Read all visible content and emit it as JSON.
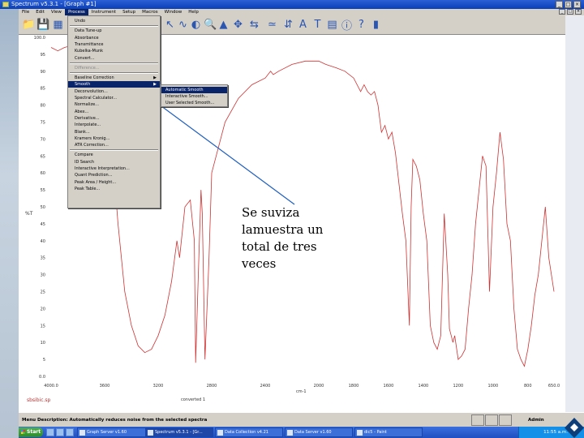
{
  "window": {
    "title": "Spectrum v5.3.1 - [Graph #1]",
    "controls": [
      "_",
      "□",
      "×"
    ]
  },
  "menubar": {
    "items": [
      "File",
      "Edit",
      "View",
      "Process",
      "Instrument",
      "Setup",
      "Macros",
      "Window",
      "Help"
    ],
    "active_index": 3
  },
  "process_menu": {
    "items": [
      {
        "label": "Undo",
        "disabled": false
      },
      {
        "label": "Data Tune-up",
        "disabled": false
      },
      {
        "label": "Absorbance",
        "disabled": false
      },
      {
        "label": "Transmittance",
        "disabled": false
      },
      {
        "label": "Kubelka-Munk",
        "disabled": false
      },
      {
        "label": "Convert...",
        "disabled": false
      },
      {
        "label": "Difference...",
        "disabled": true
      },
      {
        "label": "Baseline Correction",
        "disabled": false,
        "submenu": true
      },
      {
        "label": "Smooth",
        "disabled": false,
        "submenu": true,
        "highlighted": true
      },
      {
        "label": "Deconvolution...",
        "disabled": false
      },
      {
        "label": "Spectral Calculator...",
        "disabled": false
      },
      {
        "label": "Normalize...",
        "disabled": false
      },
      {
        "label": "Abex...",
        "disabled": false
      },
      {
        "label": "Derivative...",
        "disabled": false
      },
      {
        "label": "Interpolate...",
        "disabled": false
      },
      {
        "label": "Blank...",
        "disabled": false
      },
      {
        "label": "Kramers Kronig...",
        "disabled": false
      },
      {
        "label": "ATR Correction...",
        "disabled": false
      },
      {
        "label": "Compare",
        "disabled": false
      },
      {
        "label": "ID Search",
        "disabled": false
      },
      {
        "label": "Interactive Interpretation...",
        "disabled": false
      },
      {
        "label": "Quant Prediction...",
        "disabled": false
      },
      {
        "label": "Peak Area / Height...",
        "disabled": false
      },
      {
        "label": "Peak Table...",
        "disabled": false
      }
    ]
  },
  "smooth_submenu": {
    "items": [
      {
        "label": "Automatic Smooth",
        "highlighted": true
      },
      {
        "label": "Interactive Smooth...",
        "highlighted": false
      },
      {
        "label": "User Selected Smooth...",
        "highlighted": false
      }
    ]
  },
  "annotation": {
    "lines": [
      "Se suviza",
      "lamuestra un",
      "total de tres",
      "veces"
    ]
  },
  "graph": {
    "y_ticks": [
      "100.0",
      "95",
      "90",
      "85",
      "80",
      "75",
      "70",
      "65",
      "60",
      "55",
      "50",
      "45",
      "40",
      "35",
      "30",
      "25",
      "20",
      "15",
      "10",
      "5",
      "0.0"
    ],
    "x_ticks": [
      "4000.0",
      "3600",
      "3200",
      "2800",
      "2400",
      "2000",
      "1800",
      "1600",
      "1400",
      "1200",
      "1000",
      "800",
      "650.0"
    ],
    "ylabel": "%T",
    "xlabel": "cm-1",
    "footer_left": "sbsibic.sp",
    "footer_mid": "converted 1"
  },
  "chart_data": {
    "type": "line",
    "ylabel": "%T",
    "xlabel": "cm-1",
    "ylim": [
      0,
      100
    ],
    "x_ticks": [
      "4000.0",
      "3600",
      "3200",
      "2800",
      "2400",
      "2000",
      "1800",
      "1600",
      "1400",
      "1200",
      "1000",
      "800",
      "650.0"
    ],
    "series": [
      {
        "color": "#d03030",
        "x": [
          4000,
          3950,
          3900,
          3800,
          3700,
          3650,
          3600,
          3550,
          3500,
          3450,
          3400,
          3350,
          3300,
          3250,
          3200,
          3150,
          3100,
          3060,
          3040,
          3000,
          2960,
          2930,
          2920,
          2900,
          2880,
          2870,
          2850,
          2820,
          2800,
          2700,
          2600,
          2500,
          2400,
          2360,
          2340,
          2300,
          2200,
          2100,
          2000,
          1960,
          1900,
          1850,
          1800,
          1760,
          1740,
          1720,
          1700,
          1680,
          1660,
          1640,
          1620,
          1600,
          1580,
          1560,
          1520,
          1500,
          1480,
          1470,
          1460,
          1440,
          1420,
          1400,
          1380,
          1360,
          1340,
          1320,
          1300,
          1280,
          1260,
          1250,
          1240,
          1230,
          1220,
          1200,
          1180,
          1160,
          1140,
          1120,
          1100,
          1080,
          1060,
          1040,
          1020,
          1000,
          980,
          960,
          940,
          920,
          900,
          880,
          860,
          840,
          820,
          800,
          780,
          760,
          740,
          720,
          700,
          680,
          650
        ],
        "y": [
          97,
          96,
          97,
          98,
          96,
          93,
          85,
          70,
          45,
          25,
          15,
          9,
          7,
          8,
          12,
          18,
          28,
          40,
          35,
          50,
          52,
          40,
          4,
          30,
          55,
          48,
          5,
          35,
          60,
          75,
          82,
          86,
          88,
          90,
          89,
          90,
          92,
          93,
          93,
          92,
          91,
          90,
          88,
          84,
          86,
          84,
          83,
          84,
          80,
          72,
          74,
          70,
          72,
          66,
          48,
          40,
          15,
          50,
          64,
          62,
          58,
          48,
          40,
          15,
          10,
          8,
          12,
          48,
          30,
          14,
          12,
          10,
          12,
          5,
          6,
          8,
          20,
          30,
          45,
          55,
          65,
          62,
          25,
          50,
          60,
          72,
          64,
          45,
          40,
          20,
          8,
          5,
          3,
          8,
          15,
          24,
          30,
          40,
          50,
          35,
          25
        ]
      }
    ]
  },
  "status": {
    "label": "Menu Description:",
    "text": "Automatically reduces noise from the selected spectra",
    "user": "Admin"
  },
  "taskbar": {
    "start": "Start",
    "tasks": [
      {
        "label": "Graph Server v1.60",
        "active": false
      },
      {
        "label": "Spectrum v5.3.1 - [Gr...",
        "active": true
      },
      {
        "label": "Data Collection v4.21",
        "active": false
      },
      {
        "label": "Data Server v1.60",
        "active": false
      },
      {
        "label": "dic5 - Paint",
        "active": false
      }
    ],
    "clock": "11:55 a.m."
  }
}
